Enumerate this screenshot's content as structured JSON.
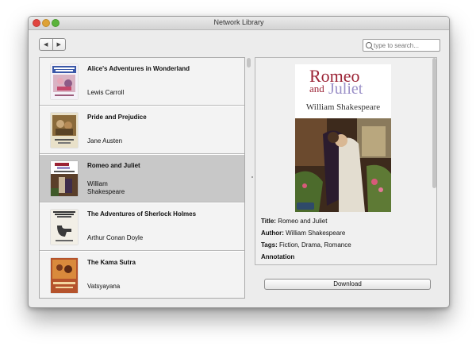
{
  "window": {
    "title": "Network Library"
  },
  "toolbar": {
    "back_glyph": "◀",
    "forward_glyph": "▶",
    "search_placeholder": "type to search..."
  },
  "books": [
    {
      "title": "Alice's Adventures in Wonderland",
      "author": "Lewis Carroll"
    },
    {
      "title": "Pride and Prejudice",
      "author": "Jane Austen"
    },
    {
      "title": "Romeo and Juliet",
      "author": "William Shakespeare"
    },
    {
      "title": "The Adventures of Sherlock Holmes",
      "author": "Arthur Conan Doyle"
    },
    {
      "title": "The Kama Sutra",
      "author": "Vatsyayana"
    }
  ],
  "selected_index": 2,
  "detail": {
    "cover": {
      "title_line1": "Romeo",
      "title_line2": "and",
      "title_line3": "Juliet",
      "author": "William Shakespeare"
    },
    "title_label": "Title:",
    "title_value": "Romeo and Juliet",
    "author_label": "Author:",
    "author_value": "William Shakespeare",
    "tags_label": "Tags:",
    "tags_value": "Fiction, Drama, Romance",
    "annotation_label": "Annotation",
    "download_label": "Download"
  },
  "colors": {
    "selection": "#c8c8c8",
    "cover_title": "#9b2335",
    "cover_accent": "#9a8fc7"
  }
}
